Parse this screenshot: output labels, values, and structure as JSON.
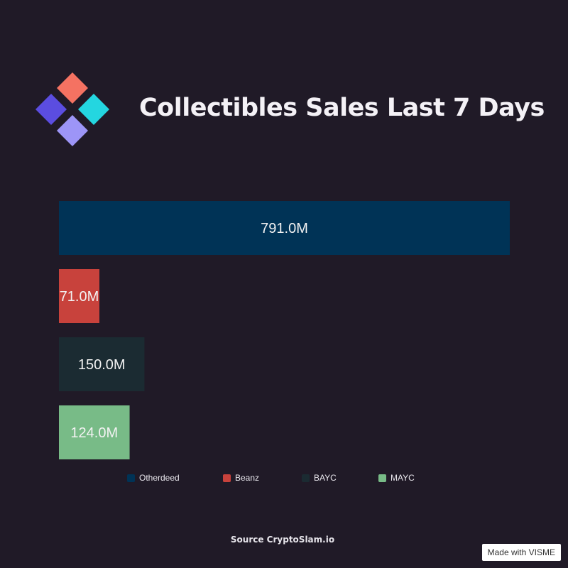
{
  "header": {
    "title": "Collectibles Sales Last 7 Days",
    "logo_icon": "diamond-grid-icon",
    "logo_colors": [
      "#f47262",
      "#5b4de0",
      "#24d6e0",
      "#9d95f7"
    ]
  },
  "chart_data": {
    "type": "bar",
    "orientation": "horizontal",
    "title": "Collectibles Sales Last 7 Days",
    "categories": [
      "Otherdeed",
      "Beanz",
      "BAYC",
      "MAYC"
    ],
    "values": [
      791.0,
      71.0,
      150.0,
      124.0
    ],
    "value_labels": [
      "791.0M",
      "71.0M",
      "150.0M",
      "124.0M"
    ],
    "colors": [
      "#003356",
      "#c8423c",
      "#1b2b32",
      "#78bb87"
    ],
    "unit": "M",
    "xlim": [
      0,
      791.0
    ],
    "grid": false,
    "legend_position": "bottom"
  },
  "footer": {
    "source": "Source CryptoSlam.io",
    "badge": "Made with VISME"
  }
}
